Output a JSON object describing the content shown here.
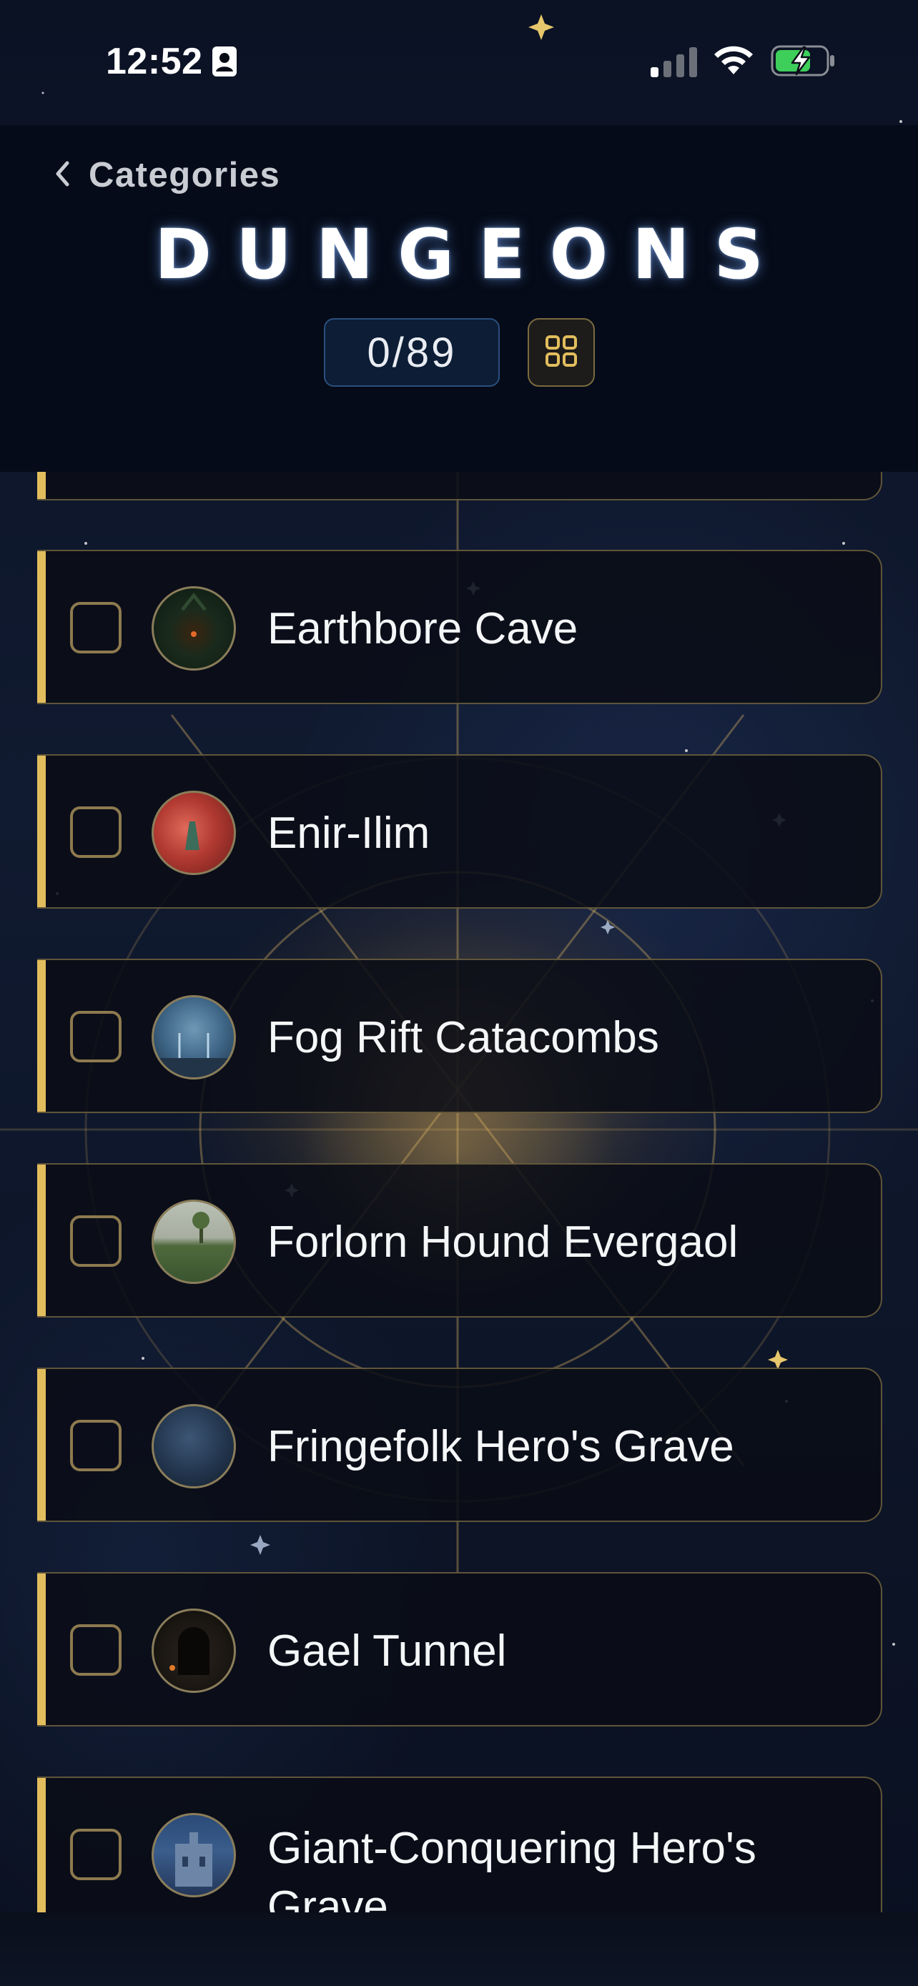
{
  "status_bar": {
    "time": "12:52"
  },
  "header": {
    "back_label": "Categories",
    "title": "DUNGEONS",
    "counter": "0/89"
  },
  "items": [
    {
      "name": "Earthbore Cave",
      "checked": false
    },
    {
      "name": "Enir-Ilim",
      "checked": false
    },
    {
      "name": "Fog Rift Catacombs",
      "checked": false
    },
    {
      "name": "Forlorn Hound Evergaol",
      "checked": false
    },
    {
      "name": "Fringefolk Hero's Grave",
      "checked": false
    },
    {
      "name": "Gael Tunnel",
      "checked": false
    },
    {
      "name": "Giant-Conquering Hero's Grave",
      "checked": false
    }
  ],
  "colors": {
    "accent": "#e1bd5d",
    "header_bg": "#050b18",
    "counter_border": "#2b4f7e",
    "card_border": "#7d6e46"
  }
}
